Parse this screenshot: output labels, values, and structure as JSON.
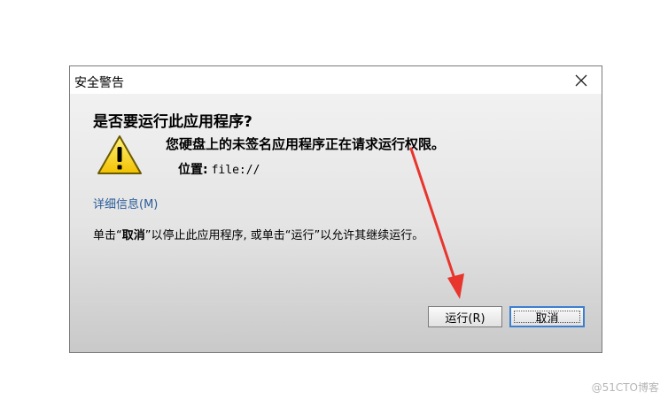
{
  "dialog": {
    "title": "安全警告",
    "heading": "是否要运行此应用程序?",
    "message": "您硬盘上的未签名应用程序正在请求运行权限。",
    "location_label": "位置:",
    "location_value": "file://",
    "details_link": "详细信息(M)",
    "instruction_before": "单击“",
    "instruction_cancel": "取消",
    "instruction_after": "”以停止此应用程序, 或单击“运行”以允许其继续运行。",
    "buttons": {
      "run": "运行(R)",
      "cancel": "取消"
    },
    "icons": {
      "close": "close-icon",
      "warning": "warning-icon"
    }
  },
  "watermark": "@51CTO博客",
  "colors": {
    "annotation_arrow": "#e8352e",
    "link": "#2a5c9a",
    "focus_border": "#3c7fd1"
  }
}
